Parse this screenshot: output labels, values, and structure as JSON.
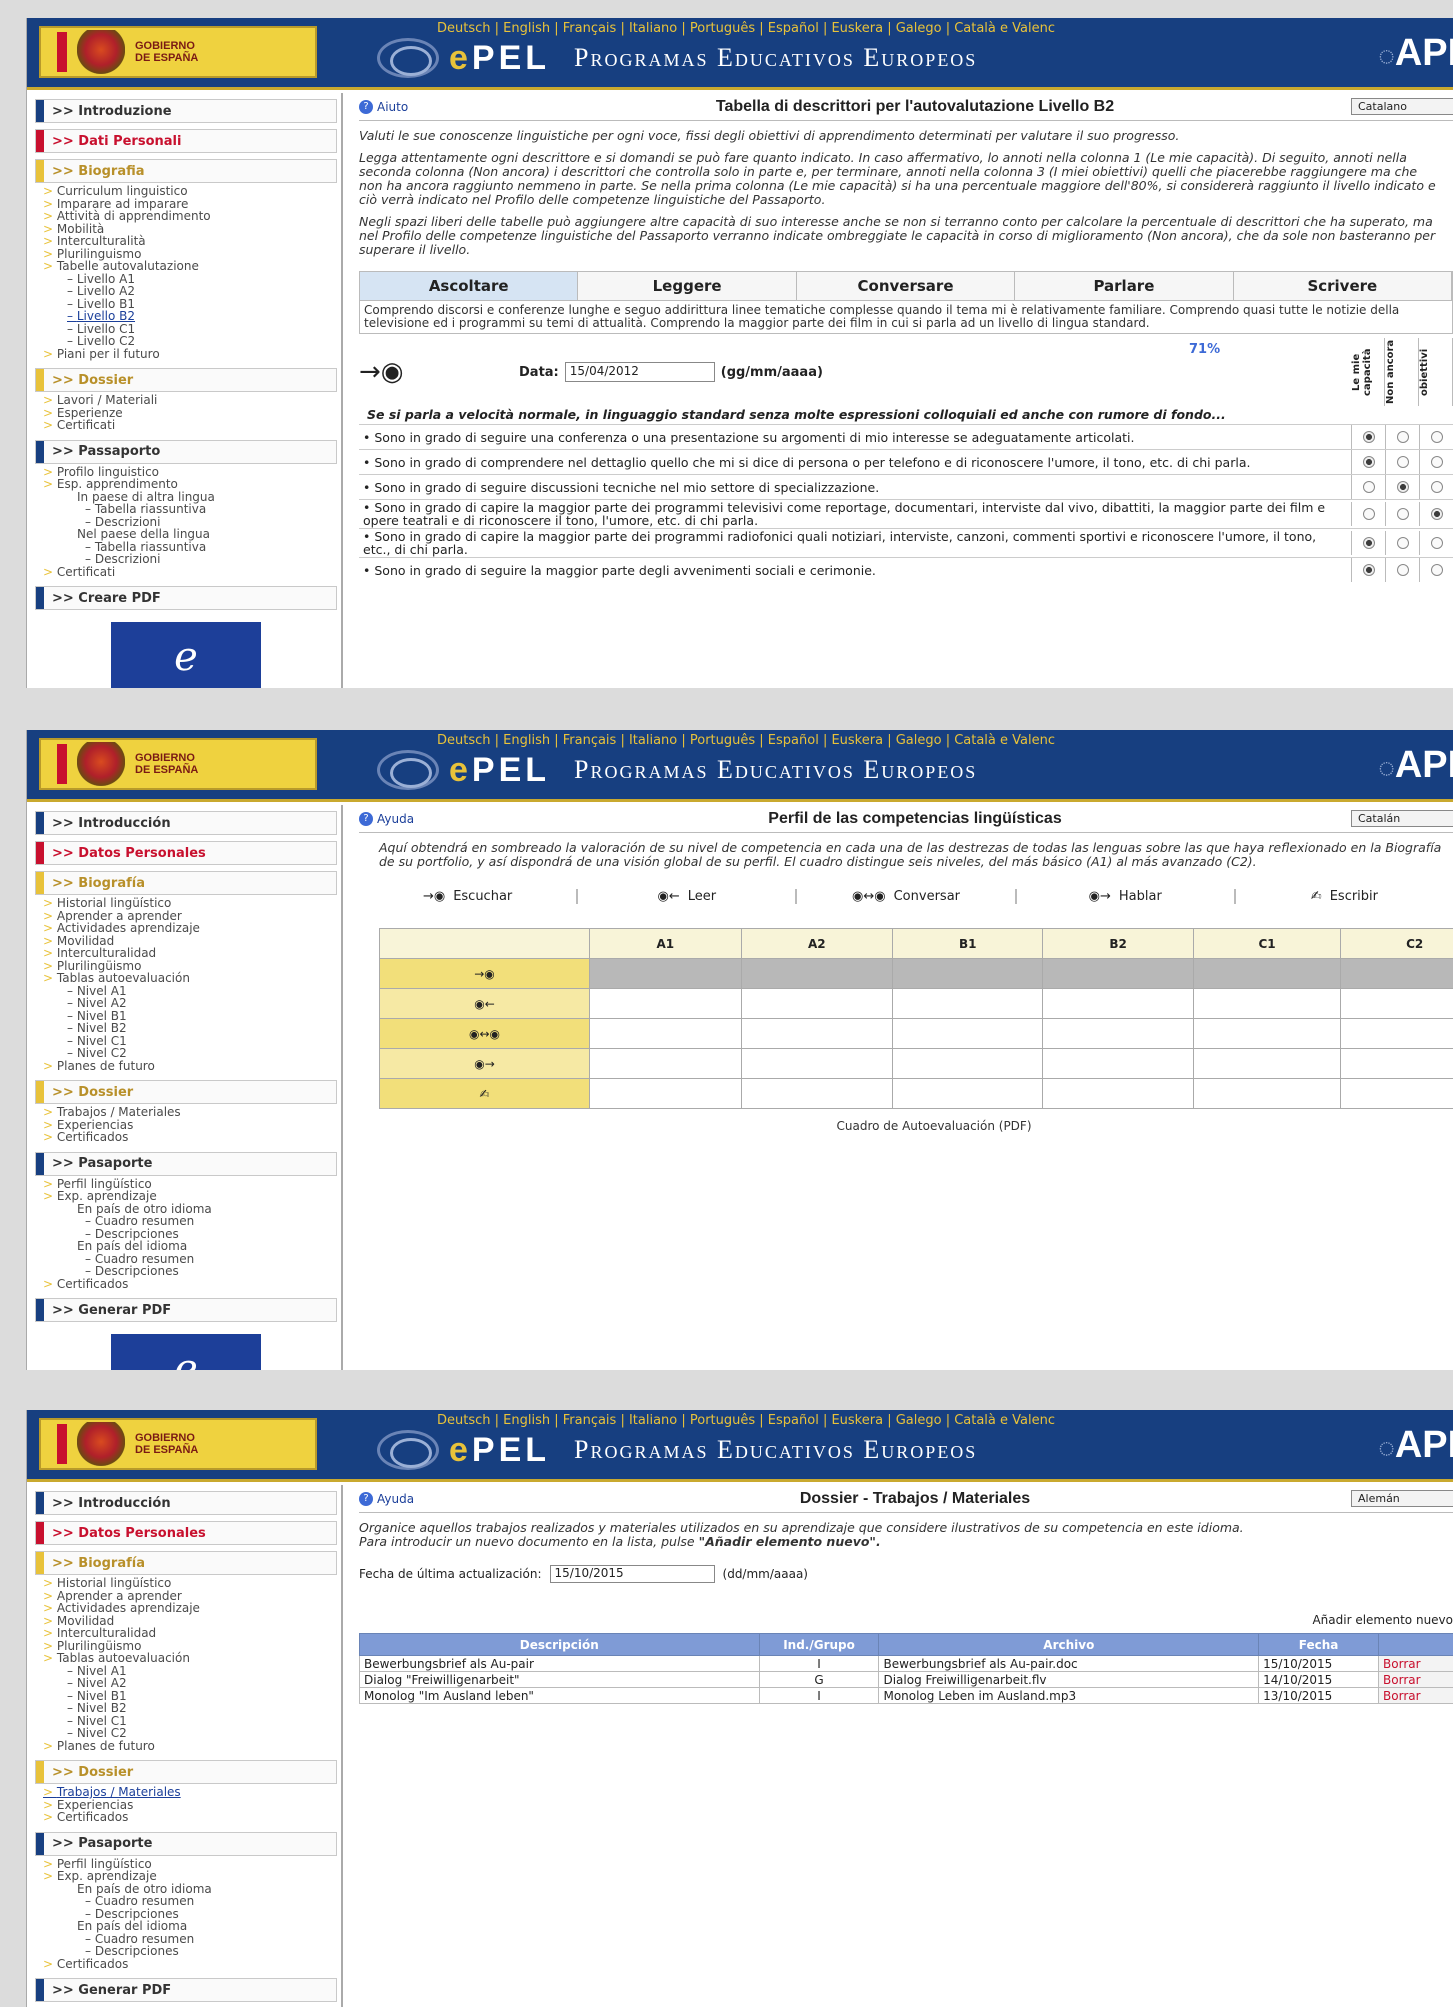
{
  "header": {
    "languages": "Deutsch | English | Français | Italiano | Português | Español | Euskera | Galego | Català e Valenc",
    "gov_text_1": "GOBIERNO",
    "gov_text_2": "DE ESPAÑA",
    "brand_e": "e",
    "brand_rest": "PEL",
    "tagline": "Programas Educativos Europeos",
    "ape": "APE"
  },
  "shot1": {
    "sidebar": {
      "s_intro": ">> Introduzione",
      "s_dati": ">> Dati Personali",
      "s_bio": ">> Biografia",
      "bio_items": [
        "Curriculum linguistico",
        "Imparare ad imparare",
        "Attività di apprendimento",
        "Mobilità",
        "Interculturalità",
        "Plurilinguismo",
        "Tabelle autovalutazione"
      ],
      "levels": [
        "Livello A1",
        "Livello A2",
        "Livello B1",
        "Livello B2",
        "Livello C1",
        "Livello C2"
      ],
      "piani": "Piani per il futuro",
      "s_dossier": ">> Dossier",
      "dossier_items": [
        "Lavori / Materiali",
        "Esperienze",
        "Certificati"
      ],
      "s_pass": ">> Passaporto",
      "pass_items": [
        "Profilo linguistico",
        "Esp. apprendimento"
      ],
      "pass_sub": [
        "In paese di altra lingua",
        "Tabella riassuntiva",
        "Descrizioni",
        "Nel paese della lingua",
        "Tabella riassuntiva",
        "Descrizioni"
      ],
      "pass_cert": "Certificati",
      "s_pdf": ">> Creare PDF"
    },
    "help": "Aiuto",
    "title": "Tabella di descrittori per l'autovalutazione  Livello B2",
    "lang_select": "Catalano",
    "intro1": "Valuti le sue conoscenze linguistiche per ogni voce, fissi degli obiettivi di apprendimento determinati per valutare il suo progresso.",
    "intro2": "Legga attentamente ogni descrittore e si domandi se può fare quanto indicato. In caso affermativo, lo annoti nella colonna 1 (Le mie capacità). Di seguito, annoti nella seconda colonna (Non ancora) i descrittori che controlla solo in parte e, per terminare, annoti nella colonna 3 (I miei obiettivi) quelli che piacerebbe raggiungere ma che non ha ancora raggiunto nemmeno in parte. Se nella prima colonna (Le mie capacità) si ha una percentuale maggiore dell'80%, si considererà raggiunto il livello indicato e ciò verrà indicato nel Profilo delle competenze linguistiche del Passaporto.",
    "intro3": "Negli spazi liberi delle tabelle può aggiungere altre capacità di suo interesse anche se non si terranno conto per calcolare la percentuale di descrittori che ha superato, ma nel Profilo delle competenze linguistiche del Passaporto verranno indicate ombreggiate le capacità in corso di miglioramento (Non ancora), che da sole non basteranno per superare il livello.",
    "tabs": [
      "Ascoltare",
      "Leggere",
      "Conversare",
      "Parlare",
      "Scrivere"
    ],
    "desc": "Comprendo discorsi e conferenze lunghe e seguo addirittura linee tematiche complesse quando il tema mi è relativamente familiare. Comprendo quasi tutte le notizie della televisione ed i programmi su temi di attualità. Comprendo la maggior parte dei film in cui si parla ad un livello di lingua standard.",
    "date_label": "Data:",
    "date_value": "15/04/2012",
    "date_format": "(gg/mm/aaaa)",
    "percent": "71%",
    "col1": "Le mie capacità",
    "col2": "Non ancora",
    "col3": "obiettivi",
    "subhead": "Se si parla a velocità normale, in linguaggio standard senza molte espressioni colloquiali ed anche con rumore di fondo...",
    "rows": [
      {
        "text": "Sono in grado di seguire una conferenza o una presentazione su argomenti di mio interesse se adeguatamente articolati.",
        "sel": 1
      },
      {
        "text": "Sono in grado di comprendere nel dettaglio quello che mi si dice di persona o per telefono e di riconoscere l'umore, il tono, etc. di chi parla.",
        "sel": 1
      },
      {
        "text": "Sono in grado di seguire discussioni tecniche nel mio settore di specializzazione.",
        "sel": 2
      },
      {
        "text": "Sono in grado di capire la maggior parte dei programmi televisivi come reportage, documentari, interviste dal vivo, dibattiti, la maggior parte dei film e opere teatrali e di riconoscere il tono, l'umore, etc. di chi parla.",
        "sel": 3
      },
      {
        "text": "Sono in grado di capire la maggior parte dei programmi radiofonici quali notiziari, interviste, canzoni, commenti sportivi e riconoscere l'umore, il tono, etc., di chi parla.",
        "sel": 1
      },
      {
        "text": "Sono in grado di seguire la maggior parte degli avvenimenti sociali e cerimonie.",
        "sel": 1
      }
    ]
  },
  "shot2": {
    "sidebar": {
      "s_intro": ">> Introducción",
      "s_datos": ">> Datos Personales",
      "s_bio": ">> Biografía",
      "bio_items": [
        "Historial lingüístico",
        "Aprender a aprender",
        "Actividades aprendizaje",
        "Movilidad",
        "Interculturalidad",
        "Plurilingüismo",
        "Tablas autoevaluación"
      ],
      "levels": [
        "Nivel A1",
        "Nivel A2",
        "Nivel B1",
        "Nivel B2",
        "Nivel C1",
        "Nivel C2"
      ],
      "planes": "Planes de futuro",
      "s_dossier": ">> Dossier",
      "dossier_items": [
        "Trabajos / Materiales",
        "Experiencias",
        "Certificados"
      ],
      "s_pass": ">> Pasaporte",
      "pass_items": [
        "Perfil lingüístico",
        "Exp. aprendizaje"
      ],
      "pass_sub": [
        "En país de otro idioma",
        "Cuadro resumen",
        "Descripciones",
        "En país del idioma",
        "Cuadro resumen",
        "Descripciones"
      ],
      "pass_cert": "Certificados",
      "s_pdf": ">> Generar PDF"
    },
    "help": "Ayuda",
    "title": "Perfil de las competencias lingüísticas",
    "lang_select": "Catalán",
    "intro": "Aquí obtendrá en sombreado la valoración de su nivel de competencia en cada una de las destrezas de todas las lenguas sobre las que haya reflexionado en la Biografía de su portfolio, y así dispondrá de una visión global de su perfil. El cuadro distingue seis niveles, del más básico (A1) al más avanzado (C2).",
    "skills": [
      "Escuchar",
      "Leer",
      "Conversar",
      "Hablar",
      "Escribir"
    ],
    "skill_icons": [
      "→◉",
      "◉←",
      "◉↔◉",
      "◉→",
      "✍"
    ],
    "levels": [
      "A1",
      "A2",
      "B1",
      "B2",
      "C1",
      "C2"
    ],
    "filled": [
      [
        1,
        1,
        1,
        1,
        1,
        1
      ],
      [
        0,
        0,
        0,
        0,
        0,
        0
      ],
      [
        0,
        0,
        0,
        0,
        0,
        0
      ],
      [
        0,
        0,
        0,
        0,
        0,
        0
      ],
      [
        0,
        0,
        0,
        0,
        0,
        0
      ]
    ],
    "caption": "Cuadro de Autoevaluación (PDF)"
  },
  "shot3": {
    "sidebar": {
      "s_intro": ">> Introducción",
      "s_datos": ">> Datos Personales",
      "s_bio": ">> Biografía",
      "bio_items": [
        "Historial lingüístico",
        "Aprender a aprender",
        "Actividades aprendizaje",
        "Movilidad",
        "Interculturalidad",
        "Plurilingüismo",
        "Tablas autoevaluación"
      ],
      "levels": [
        "Nivel A1",
        "Nivel A2",
        "Nivel B1",
        "Nivel B2",
        "Nivel C1",
        "Nivel C2"
      ],
      "planes": "Planes de futuro",
      "s_dossier": ">> Dossier",
      "dossier_items": [
        "Trabajos / Materiales",
        "Experiencias",
        "Certificados"
      ],
      "s_pass": ">> Pasaporte",
      "pass_items": [
        "Perfil lingüístico",
        "Exp. aprendizaje"
      ],
      "pass_sub": [
        "En país de otro idioma",
        "Cuadro resumen",
        "Descripciones",
        "En país del idioma",
        "Cuadro resumen",
        "Descripciones"
      ],
      "pass_cert": "Certificados",
      "s_pdf": ">> Generar PDF"
    },
    "help": "Ayuda",
    "title": "Dossier - Trabajos / Materiales",
    "lang_select": "Alemán",
    "intro1": "Organice aquellos trabajos realizados y materiales utilizados en su aprendizaje que considere ilustrativos de su competencia en este idioma.",
    "intro2a": "Para introducir un nuevo documento en la lista, pulse ",
    "intro2b": "\"Añadir elemento nuevo\".",
    "upd_label": "Fecha de última actualización:",
    "upd_value": "15/10/2015",
    "upd_format": "(dd/mm/aaaa)",
    "add_link": "Añadir elemento nuevo",
    "cols": [
      "Descripción",
      "Ind./Grupo",
      "Archivo",
      "Fecha",
      ""
    ],
    "rows": [
      {
        "desc": "Bewerbungsbrief als Au-pair",
        "grp": "I",
        "file": "Bewerbungsbrief als Au-pair.doc",
        "date": "15/10/2015",
        "del": "Borrar"
      },
      {
        "desc": "Dialog \"Freiwilligenarbeit\"",
        "grp": "G",
        "file": "Dialog Freiwilligenarbeit.flv",
        "date": "14/10/2015",
        "del": "Borrar"
      },
      {
        "desc": "Monolog \"Im Ausland leben\"",
        "grp": "I",
        "file": "Monolog Leben im Ausland.mp3",
        "date": "13/10/2015",
        "del": "Borrar"
      }
    ]
  }
}
